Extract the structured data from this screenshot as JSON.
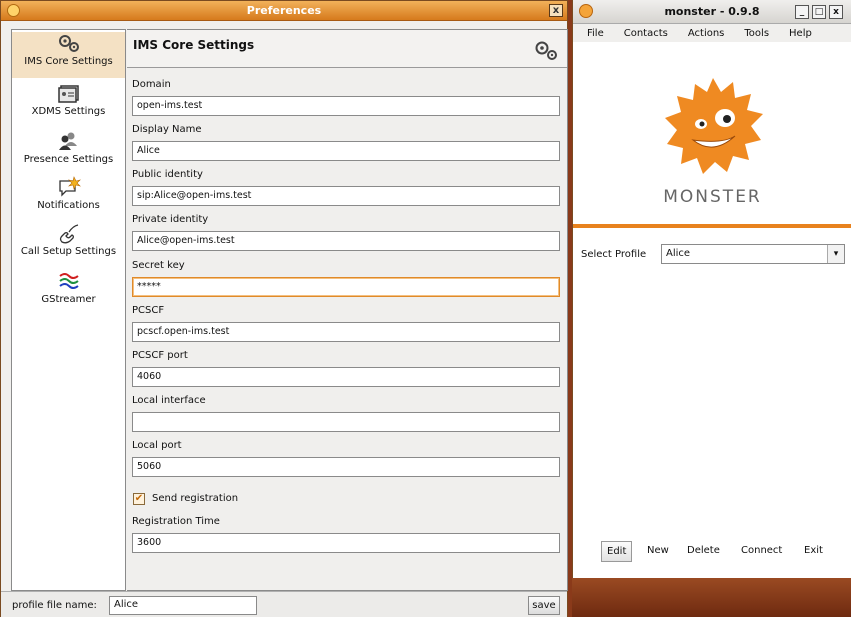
{
  "preferences": {
    "title": "Preferences",
    "sidebar": [
      {
        "label": "IMS Core Settings",
        "icon": "gears-icon"
      },
      {
        "label": "XDMS Settings",
        "icon": "contact-card-icon"
      },
      {
        "label": "Presence Settings",
        "icon": "people-icon"
      },
      {
        "label": "Notifications",
        "icon": "speech-burst-icon"
      },
      {
        "label": "Call Setup Settings",
        "icon": "phone-handset-icon"
      },
      {
        "label": "GStreamer",
        "icon": "wave-lines-icon"
      }
    ],
    "header_title": "IMS Core Settings",
    "fields": [
      {
        "label": "Domain",
        "value": "open-ims.test"
      },
      {
        "label": "Display Name",
        "value": "Alice"
      },
      {
        "label": "Public identity",
        "value": "sip:Alice@open-ims.test"
      },
      {
        "label": "Private identity",
        "value": "Alice@open-ims.test"
      },
      {
        "label": "Secret key",
        "value": "*****"
      },
      {
        "label": "PCSCF",
        "value": "pcscf.open-ims.test"
      },
      {
        "label": "PCSCF port",
        "value": "4060"
      },
      {
        "label": "Local interface",
        "value": ""
      },
      {
        "label": "Local port",
        "value": "5060"
      }
    ],
    "send_registration": {
      "label": "Send registration",
      "checked": true
    },
    "registration_time": {
      "label": "Registration Time",
      "value": "3600"
    },
    "bottom": {
      "profile_label": "profile file name:",
      "profile_value": "Alice",
      "save_label": "save"
    }
  },
  "monster": {
    "title": "monster - 0.9.8",
    "menu": [
      "File",
      "Contacts",
      "Actions",
      "Tools",
      "Help"
    ],
    "logo_text": "MONSTER",
    "select_profile_label": "Select Profile",
    "select_profile_value": "Alice",
    "actions": [
      "Edit",
      "New",
      "Delete",
      "Connect",
      "Exit"
    ],
    "accent": "#e8821e"
  }
}
